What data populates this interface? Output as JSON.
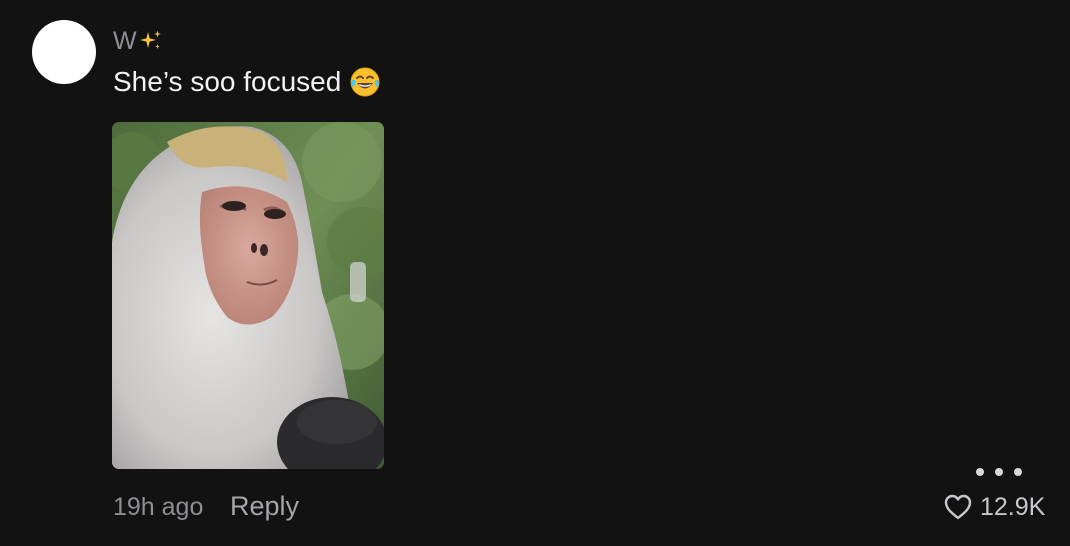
{
  "comment": {
    "username": "W",
    "username_icon": "sparkles-icon",
    "text": "She’s soo focused",
    "text_emoji": "face-with-tears-of-joy-icon",
    "photo": "monkey-photo",
    "timestamp": "19h ago",
    "reply_label": "Reply",
    "like_count": "12.9K",
    "more_icon": "more-dots-icon",
    "like_icon": "heart-outline-icon"
  },
  "colors": {
    "background": "#121213",
    "text_primary": "#f2f2f2",
    "text_secondary": "#8e8e93",
    "avatar": "#ffffff",
    "sparkle": "#f5c542"
  }
}
